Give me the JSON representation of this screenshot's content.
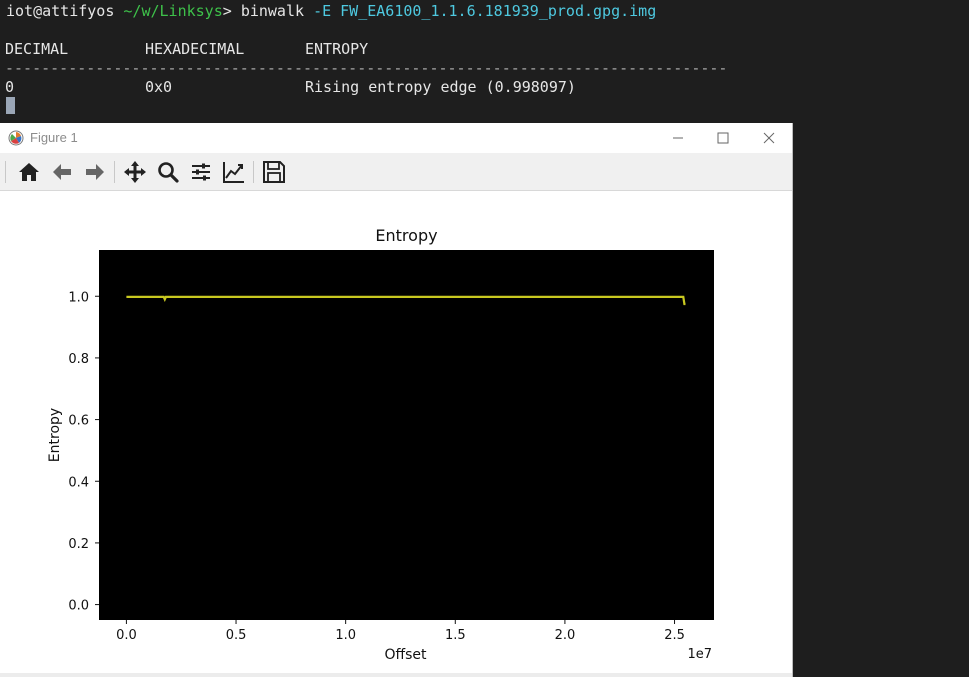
{
  "terminal": {
    "prompt_user": "iot@attifyos",
    "prompt_path": "~/w/Linksys",
    "prompt_symbol": ">",
    "command": "binwalk",
    "flag": "-E",
    "filename": "FW_EA6100_1.1.6.181939_prod.gpg.img",
    "headers": {
      "decimal": "DECIMAL",
      "hex": "HEXADECIMAL",
      "entropy": "ENTROPY"
    },
    "divider": "--------------------------------------------------------------------------------",
    "row": {
      "decimal": "0",
      "hex": "0x0",
      "description": "Rising entropy edge (0.998097)"
    }
  },
  "window": {
    "title": "Figure 1",
    "toolbar": [
      "home-icon",
      "back-icon",
      "forward-icon",
      "pan-icon",
      "zoom-icon",
      "configure-subplots-icon",
      "edit-axis-icon",
      "save-icon"
    ],
    "bottom_strip_color": "#ececec"
  },
  "chart_data": {
    "type": "line",
    "title": "Entropy",
    "xlabel": "Offset",
    "ylabel": "Entropy",
    "x_offset_text": "1e7",
    "xlim": [
      -0.125,
      2.68
    ],
    "ylim": [
      -0.05,
      1.15
    ],
    "xticks": [
      0.0,
      0.5,
      1.0,
      1.5,
      2.0,
      2.5
    ],
    "xtick_labels": [
      "0.0",
      "0.5",
      "1.0",
      "1.5",
      "2.0",
      "2.5"
    ],
    "yticks": [
      0.0,
      0.2,
      0.4,
      0.6,
      0.8,
      1.0
    ],
    "ytick_labels": [
      "0.0",
      "0.2",
      "0.4",
      "0.6",
      "0.8",
      "1.0"
    ],
    "background": "#000000",
    "line_color": "#c8c820",
    "series": [
      {
        "x": [
          0.0,
          0.17,
          0.175,
          0.18,
          0.5,
          1.0,
          1.5,
          2.0,
          2.5,
          2.54,
          2.545,
          2.55
        ],
        "y": [
          0.998,
          0.998,
          0.99,
          0.998,
          0.998,
          0.998,
          0.998,
          0.998,
          0.998,
          0.998,
          0.975,
          0.975
        ]
      }
    ]
  }
}
